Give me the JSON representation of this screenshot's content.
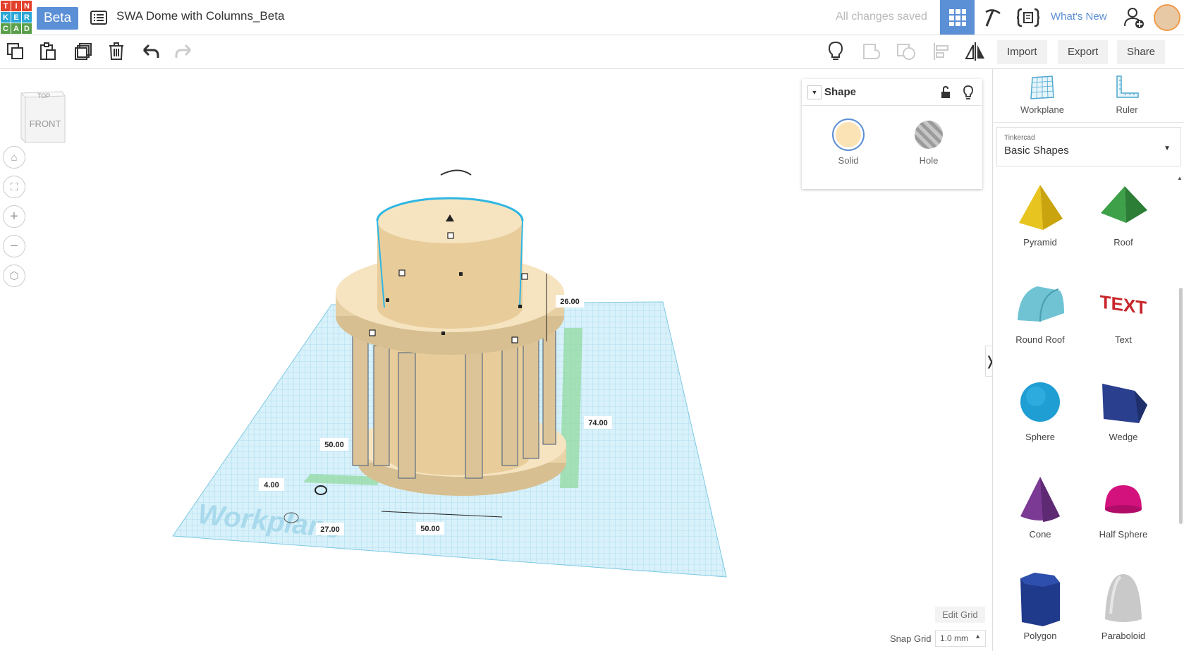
{
  "header": {
    "logo_letters": [
      "T",
      "I",
      "N",
      "K",
      "E",
      "R",
      "C",
      "A",
      "D"
    ],
    "logo_colors": [
      "#e2412b",
      "#e2412b",
      "#e2412b",
      "#2aa6d8",
      "#2aa6d8",
      "#2aa6d8",
      "#5aa04a",
      "#5aa04a",
      "#5aa04a"
    ],
    "beta_label": "Beta",
    "doc_title": "SWA Dome with Columns_Beta",
    "saved_status": "All changes saved",
    "whats_new": "What's New"
  },
  "toolbar": {
    "import_label": "Import",
    "export_label": "Export",
    "share_label": "Share"
  },
  "viewcube": {
    "top_label": "TOP",
    "front_label": "FRONT"
  },
  "shape_panel": {
    "title": "Shape",
    "solid_label": "Solid",
    "hole_label": "Hole",
    "solid_color": "#fbe3b6"
  },
  "dimensions": {
    "height_top": "26.00",
    "height_total": "74.00",
    "width_left": "50.00",
    "width_bottom": "50.00",
    "elev": "4.00",
    "offset": "27.00"
  },
  "workplane_label": "Workplane",
  "grid_controls": {
    "edit_grid": "Edit Grid",
    "snap_label": "Snap Grid",
    "snap_value": "1.0 mm"
  },
  "right_panel": {
    "workplane_label": "Workplane",
    "ruler_label": "Ruler",
    "library_category": "Tinkercad",
    "library_name": "Basic Shapes",
    "shapes": [
      {
        "label": "Pyramid",
        "icon": "pyramid-icon"
      },
      {
        "label": "Roof",
        "icon": "roof-icon"
      },
      {
        "label": "Round Roof",
        "icon": "round-roof-icon"
      },
      {
        "label": "Text",
        "icon": "text-shape-icon"
      },
      {
        "label": "Sphere",
        "icon": "sphere-icon"
      },
      {
        "label": "Wedge",
        "icon": "wedge-icon"
      },
      {
        "label": "Cone",
        "icon": "cone-icon"
      },
      {
        "label": "Half Sphere",
        "icon": "half-sphere-icon"
      },
      {
        "label": "Polygon",
        "icon": "polygon-icon"
      },
      {
        "label": "Paraboloid",
        "icon": "paraboloid-icon"
      }
    ],
    "text_shape_glyph": "TEXT"
  },
  "accent_color": "#5b8fd6"
}
